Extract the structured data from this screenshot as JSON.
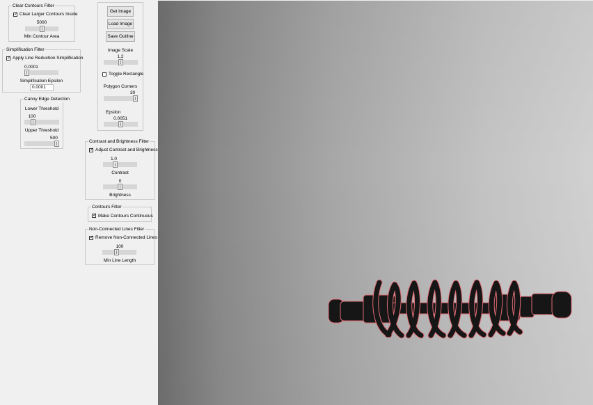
{
  "clear_contours": {
    "title": "Clear Contours Filter",
    "checkbox_label": "Clear Larger Contours Inside",
    "checked": true,
    "value": "5000",
    "value_fraction": 0.5,
    "caption": "Min Contour Area"
  },
  "simplification": {
    "title": "Simplification Filter",
    "checkbox_label": "Apply Line Reduction Simplification",
    "checked": true,
    "value": "0.0001",
    "value_fraction": 0.0,
    "caption": "Simplification Epsilon",
    "entry_value": "0.0001"
  },
  "canny": {
    "title": "Canny Edge Detection",
    "lower_label": "Lower Threshold",
    "lower_value": "100",
    "lower_fraction": 0.2,
    "upper_label": "Upper Threshold",
    "upper_value": "500",
    "upper_fraction": 1.0
  },
  "actions": {
    "get_image": "Get Image",
    "load_image": "Load Image",
    "save_outline": "Save Outline"
  },
  "image_scale": {
    "label": "Image Scale",
    "value": "1.2",
    "value_fraction": 0.5
  },
  "toggle_rectangle": {
    "label": "Toggle Rectangle",
    "checked": false
  },
  "polygon_corners": {
    "label": "Polygon Corners",
    "value": "30",
    "value_fraction": 1.0
  },
  "epsilon": {
    "label": "Epsilon",
    "value": "0.0051",
    "value_fraction": 0.5
  },
  "contrast_brightness": {
    "title": "Contrast and Brightness Filter",
    "checkbox_label": "Adjust Contrast and Brightness",
    "checked": true,
    "contrast_value": "1.0",
    "contrast_fraction": 0.33,
    "contrast_label": "Contrast",
    "brightness_value": "0",
    "brightness_fraction": 0.5,
    "brightness_label": "Brightness"
  },
  "contours_filter": {
    "title": "Contours Filter",
    "checkbox_label": "Make Contours Continuous",
    "checked": true
  },
  "nonconnected": {
    "title": "Non-Connected Lines Filter",
    "checkbox_label": "Remove Non-Connected Lines",
    "checked": true,
    "value": "100",
    "value_fraction": 0.4,
    "caption": "Min Line Length"
  },
  "viewer": {
    "outline_color": "#e06b74",
    "part_color": "#161616"
  }
}
